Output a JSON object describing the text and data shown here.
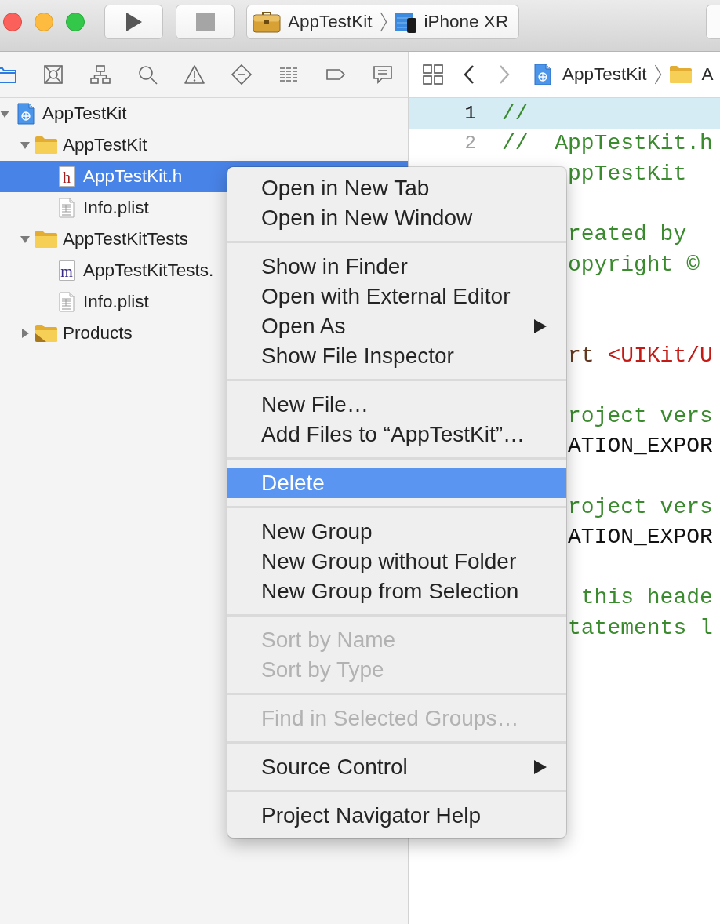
{
  "toolbar": {
    "scheme": {
      "target": "AppTestKit",
      "device": "iPhone XR"
    }
  },
  "navigator": {
    "tree": [
      {
        "label": "AppTestKit",
        "kind": "project",
        "expanded": true,
        "selected": false,
        "children": [
          {
            "label": "AppTestKit",
            "kind": "folder",
            "expanded": true,
            "selected": false,
            "children": [
              {
                "label": "AppTestKit.h",
                "kind": "header",
                "icon_text": "h",
                "selected": true
              },
              {
                "label": "Info.plist",
                "kind": "plist",
                "selected": false
              }
            ]
          },
          {
            "label": "AppTestKitTests",
            "kind": "folder",
            "expanded": true,
            "selected": false,
            "children": [
              {
                "label": "AppTestKitTests.",
                "kind": "source",
                "icon_text": "m",
                "selected": false
              },
              {
                "label": "Info.plist",
                "kind": "plist",
                "selected": false
              }
            ]
          },
          {
            "label": "Products",
            "kind": "products",
            "expanded": false,
            "selected": false
          }
        ]
      }
    ]
  },
  "editor": {
    "jump_bar": [
      {
        "kind": "project",
        "label": "AppTestKit"
      },
      {
        "kind": "folder",
        "label": "A"
      }
    ],
    "lines": [
      {
        "kind": "code",
        "number": "1",
        "current": true,
        "tokens": [
          {
            "kind": "comment",
            "text": "//"
          }
        ]
      },
      {
        "kind": "code",
        "number": "2",
        "current": false,
        "tokens": [
          {
            "kind": "comment",
            "text": "//  AppTestKit.h"
          }
        ]
      },
      {
        "kind": "fragment",
        "tokens": [
          {
            "kind": "comment",
            "text": "ppTestKit"
          }
        ]
      },
      {
        "kind": "blank"
      },
      {
        "kind": "fragment",
        "tokens": [
          {
            "kind": "comment",
            "text": "reated by"
          }
        ]
      },
      {
        "kind": "fragment",
        "tokens": [
          {
            "kind": "comment",
            "text": "opyright ©"
          }
        ]
      },
      {
        "kind": "blank"
      },
      {
        "kind": "blank"
      },
      {
        "kind": "fragment",
        "tokens": [
          {
            "kind": "preprocessor",
            "text": "rt"
          },
          {
            "kind": "string",
            "text": " <UIKit/U"
          }
        ]
      },
      {
        "kind": "blank"
      },
      {
        "kind": "fragment",
        "tokens": [
          {
            "kind": "comment",
            "text": "roject vers"
          }
        ]
      },
      {
        "kind": "fragment",
        "tokens": [
          {
            "kind": "plain",
            "text": "ATION_EXPOR"
          }
        ]
      },
      {
        "kind": "blank"
      },
      {
        "kind": "fragment",
        "tokens": [
          {
            "kind": "comment",
            "text": "roject vers"
          }
        ]
      },
      {
        "kind": "fragment",
        "tokens": [
          {
            "kind": "plain",
            "text": "ATION_EXPOR"
          }
        ]
      },
      {
        "kind": "blank"
      },
      {
        "kind": "fragment",
        "tokens": [
          {
            "kind": "comment",
            "text": " this heade"
          }
        ]
      },
      {
        "kind": "fragment",
        "tokens": [
          {
            "kind": "comment",
            "text": "tatements l"
          }
        ]
      }
    ]
  },
  "context_menu": {
    "sections": [
      {
        "items": [
          {
            "label": "Open in New Tab",
            "selected": false,
            "disabled": false,
            "submenu": false
          },
          {
            "label": "Open in New Window",
            "selected": false,
            "disabled": false,
            "submenu": false
          }
        ]
      },
      {
        "items": [
          {
            "label": "Show in Finder",
            "selected": false,
            "disabled": false,
            "submenu": false
          },
          {
            "label": "Open with External Editor",
            "selected": false,
            "disabled": false,
            "submenu": false
          },
          {
            "label": "Open As",
            "selected": false,
            "disabled": false,
            "submenu": true
          },
          {
            "label": "Show File Inspector",
            "selected": false,
            "disabled": false,
            "submenu": false
          }
        ]
      },
      {
        "items": [
          {
            "label": "New File…",
            "selected": false,
            "disabled": false,
            "submenu": false
          },
          {
            "label": "Add Files to “AppTestKit”…",
            "selected": false,
            "disabled": false,
            "submenu": false
          }
        ]
      },
      {
        "items": [
          {
            "label": "Delete",
            "selected": true,
            "disabled": false,
            "submenu": false
          }
        ]
      },
      {
        "items": [
          {
            "label": "New Group",
            "selected": false,
            "disabled": false,
            "submenu": false
          },
          {
            "label": "New Group without Folder",
            "selected": false,
            "disabled": false,
            "submenu": false
          },
          {
            "label": "New Group from Selection",
            "selected": false,
            "disabled": false,
            "submenu": false
          }
        ]
      },
      {
        "items": [
          {
            "label": "Sort by Name",
            "selected": false,
            "disabled": true,
            "submenu": false
          },
          {
            "label": "Sort by Type",
            "selected": false,
            "disabled": true,
            "submenu": false
          }
        ]
      },
      {
        "items": [
          {
            "label": "Find in Selected Groups…",
            "selected": false,
            "disabled": true,
            "submenu": false
          }
        ]
      },
      {
        "items": [
          {
            "label": "Source Control",
            "selected": false,
            "disabled": false,
            "submenu": true
          }
        ]
      },
      {
        "items": [
          {
            "label": "Project Navigator Help",
            "selected": false,
            "disabled": false,
            "submenu": false
          }
        ]
      }
    ]
  }
}
